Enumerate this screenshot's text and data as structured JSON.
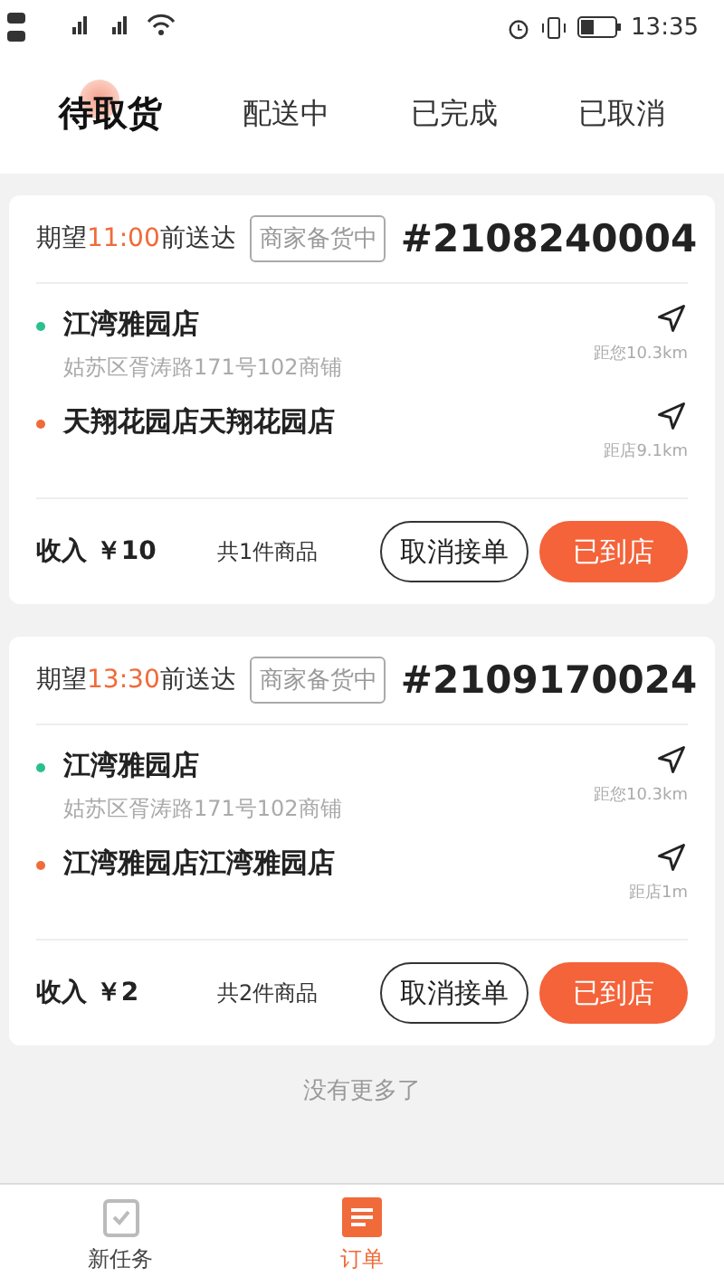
{
  "status_bar": {
    "time": "13:35"
  },
  "tabs": [
    {
      "label": "待取货",
      "selected": true
    },
    {
      "label": "配送中",
      "selected": false
    },
    {
      "label": "已完成",
      "selected": false
    },
    {
      "label": "已取消",
      "selected": false
    }
  ],
  "orders": [
    {
      "expect_prefix": "期望",
      "expect_time": "11:00",
      "expect_suffix": "前送达",
      "status": "商家备货中",
      "number": "#2108240004",
      "stops": [
        {
          "kind": "pickup",
          "name": "江湾雅园店",
          "address": "姑苏区胥涛路171号102商铺",
          "distance": "距您10.3km"
        },
        {
          "kind": "dropoff",
          "name": "天翔花园店天翔花园店",
          "distance": "距店9.1km"
        }
      ],
      "income": "收入 ￥10",
      "items": "共1件商品",
      "cancel": "取消接单",
      "arrived": "已到店"
    },
    {
      "expect_prefix": "期望",
      "expect_time": "13:30",
      "expect_suffix": "前送达",
      "status": "商家备货中",
      "number": "#2109170024",
      "stops": [
        {
          "kind": "pickup",
          "name": "江湾雅园店",
          "address": "姑苏区胥涛路171号102商铺",
          "distance": "距您10.3km"
        },
        {
          "kind": "dropoff",
          "name": "江湾雅园店江湾雅园店",
          "distance": "距店1m"
        }
      ],
      "income": "收入 ￥2",
      "items": "共2件商品",
      "cancel": "取消接单",
      "arrived": "已到店"
    }
  ],
  "end_note": "没有更多了",
  "nav": [
    {
      "label": "新任务",
      "selected": false
    },
    {
      "label": "订单",
      "selected": true
    }
  ]
}
